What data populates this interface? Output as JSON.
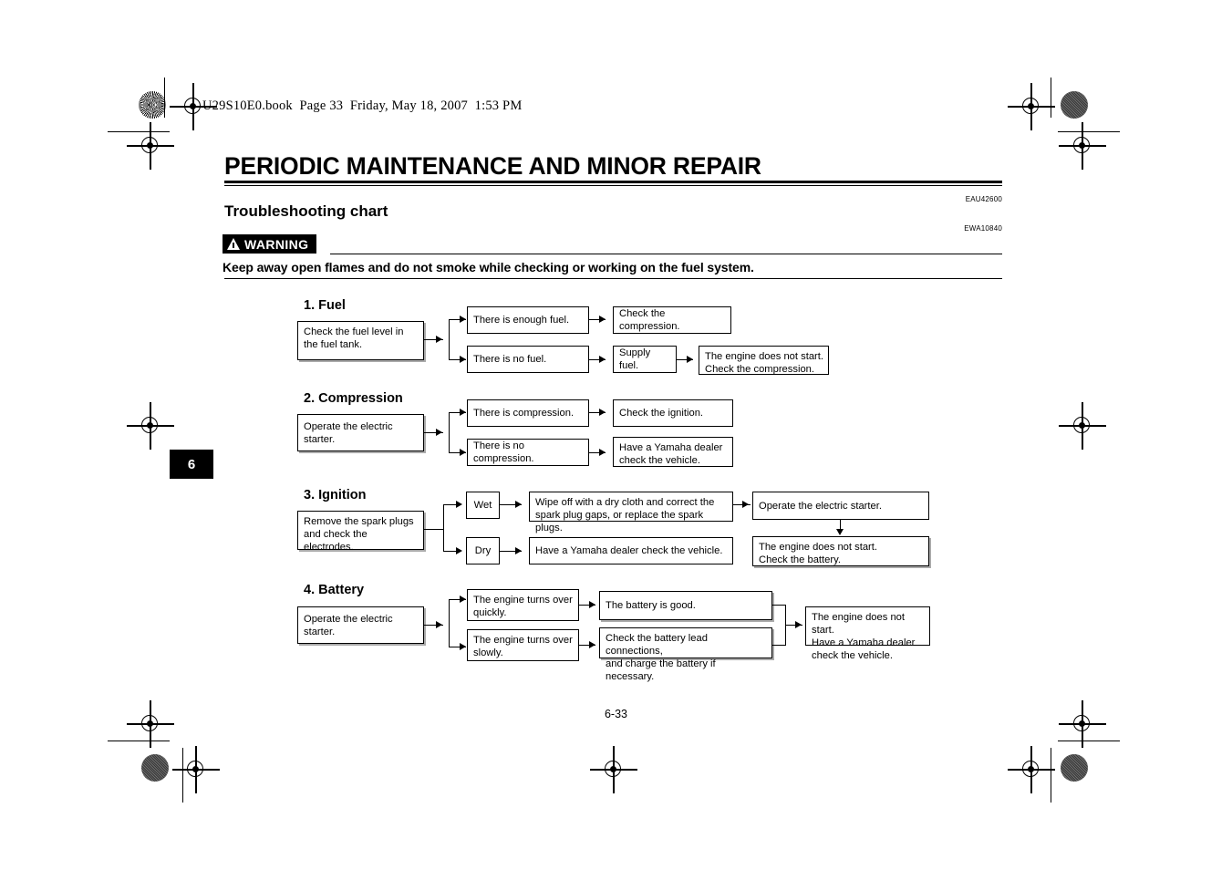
{
  "slug": "U29S10E0.book  Page 33  Friday, May 18, 2007  1:53 PM",
  "chapter_title": "PERIODIC MAINTENANCE AND MINOR REPAIR",
  "section_title": "Troubleshooting chart",
  "ref_codes": {
    "section": "EAU42600",
    "warning": "EWA10840"
  },
  "warning": {
    "label": "WARNING",
    "body": "Keep away open flames and do not smoke while checking or working on the fuel system."
  },
  "chapter_tab": "6",
  "folio": "6-33",
  "chart_data": {
    "type": "diagram",
    "title": "Troubleshooting chart",
    "sections": [
      {
        "heading": "1. Fuel",
        "start": "Check the fuel level in\nthe fuel tank.",
        "branches": [
          {
            "condition": "There is enough fuel.",
            "steps": [
              "Check the compression."
            ]
          },
          {
            "condition": "There is no fuel.",
            "steps": [
              "Supply fuel.",
              "The engine does not start.\nCheck the compression."
            ]
          }
        ]
      },
      {
        "heading": "2. Compression",
        "start": "Operate the electric starter.",
        "branches": [
          {
            "condition": "There is compression.",
            "steps": [
              "Check the ignition."
            ]
          },
          {
            "condition": "There is no compression.",
            "steps": [
              "Have a Yamaha dealer\ncheck the vehicle."
            ]
          }
        ]
      },
      {
        "heading": "3. Ignition",
        "start": "Remove the spark plugs\nand check the electrodes.",
        "branches": [
          {
            "condition": "Wet",
            "steps": [
              "Wipe off with a dry cloth and correct the\nspark plug gaps, or replace the spark plugs.",
              "Operate the electric starter.",
              "The engine does not start.\nCheck the battery."
            ]
          },
          {
            "condition": "Dry",
            "steps": [
              "Have a Yamaha dealer check the vehicle."
            ]
          }
        ]
      },
      {
        "heading": "4. Battery",
        "start": "Operate the electric starter.",
        "branches": [
          {
            "condition": "The engine turns over\nquickly.",
            "steps": [
              "The battery is good."
            ]
          },
          {
            "condition": "The engine turns over\nslowly.",
            "steps": [
              "Check the battery lead connections,\nand charge the battery if necessary."
            ]
          }
        ],
        "merge": "The engine does not start.\nHave a Yamaha dealer\ncheck the vehicle."
      }
    ]
  }
}
